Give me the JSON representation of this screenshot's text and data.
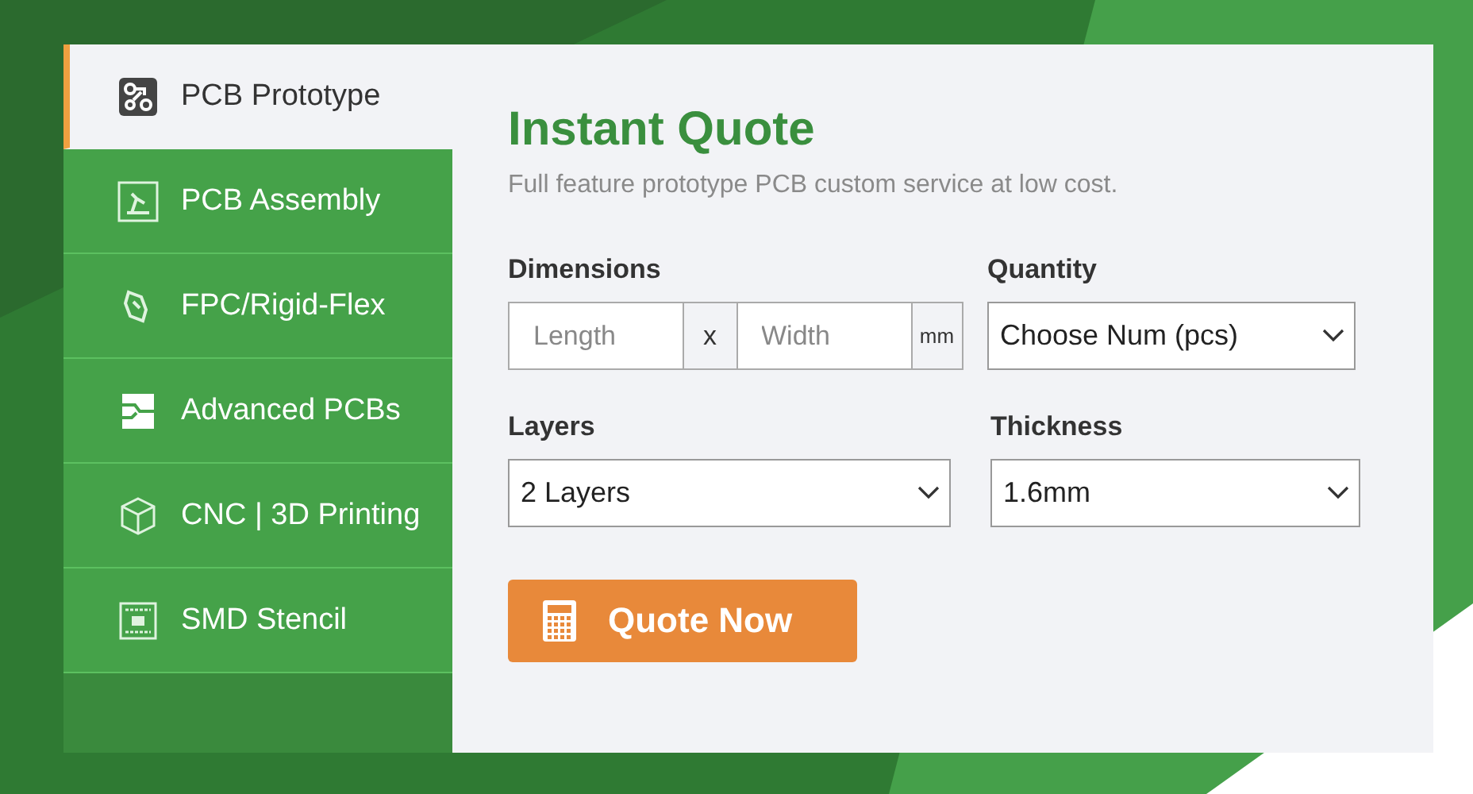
{
  "sidebar": {
    "items": [
      {
        "label": "PCB Prototype",
        "selected": true
      },
      {
        "label": "PCB Assembly",
        "selected": false
      },
      {
        "label": "FPC/Rigid-Flex",
        "selected": false
      },
      {
        "label": "Advanced PCBs",
        "selected": false
      },
      {
        "label": "CNC | 3D Printing",
        "selected": false
      },
      {
        "label": "SMD Stencil",
        "selected": false
      }
    ]
  },
  "quote": {
    "title": "Instant Quote",
    "subtitle": "Full feature prototype PCB custom service at low cost.",
    "dimensions": {
      "label": "Dimensions",
      "length": {
        "placeholder": "Length"
      },
      "separator": "x",
      "width": {
        "placeholder": "Width"
      },
      "unit": "mm"
    },
    "quantity": {
      "label": "Quantity",
      "value": "Choose Num (pcs)"
    },
    "layers": {
      "label": "Layers",
      "value": "2 Layers"
    },
    "thickness": {
      "label": "Thickness",
      "value": "1.6mm"
    },
    "button": {
      "label": "Quote Now"
    }
  }
}
